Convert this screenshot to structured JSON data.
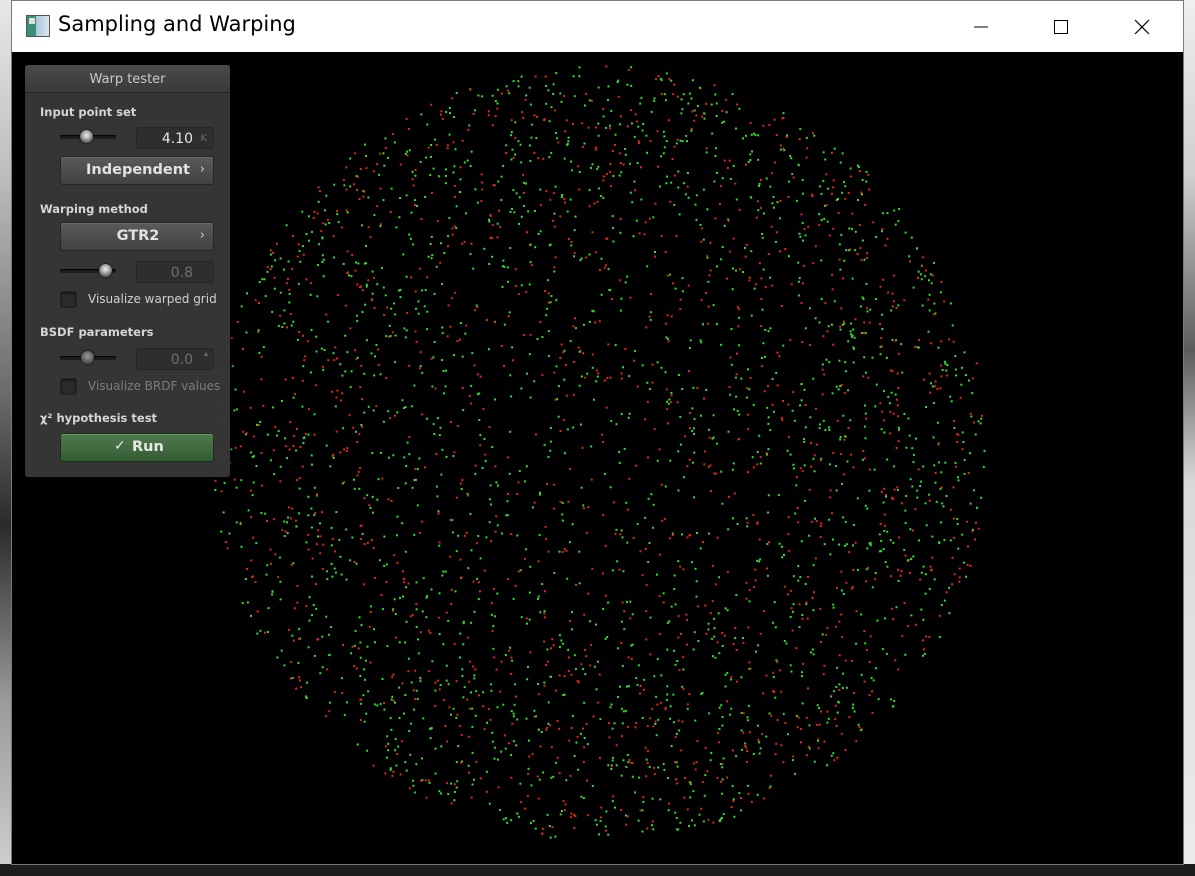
{
  "window": {
    "title": "Sampling and Warping",
    "controls": [
      "minimize",
      "maximize",
      "close"
    ]
  },
  "panel": {
    "title": "Warp tester",
    "input_point_set": {
      "label": "Input point set",
      "point_count": "4.10",
      "point_count_unit": "K",
      "sampler": "Independent"
    },
    "warping_method": {
      "label": "Warping method",
      "method": "GTR2",
      "parameter": "0.8",
      "visualize_grid_label": "Visualize warped grid",
      "visualize_grid_checked": false
    },
    "bsdf": {
      "label": "BSDF parameters",
      "parameter": "0.0",
      "visualize_brdf_label": "Visualize BRDF values",
      "visualize_brdf_checked": false,
      "enabled": false
    },
    "hypothesis_test": {
      "label": "χ² hypothesis test",
      "run_label": "Run",
      "run_icon": "check-icon"
    }
  },
  "colors": {
    "point_green": "#33dd33",
    "point_red": "#dd2a1a",
    "run_button": "#4a7548",
    "background": "#000000"
  },
  "icons": {
    "app": "app-icon",
    "combo_arrow": "chevron-right-icon"
  }
}
